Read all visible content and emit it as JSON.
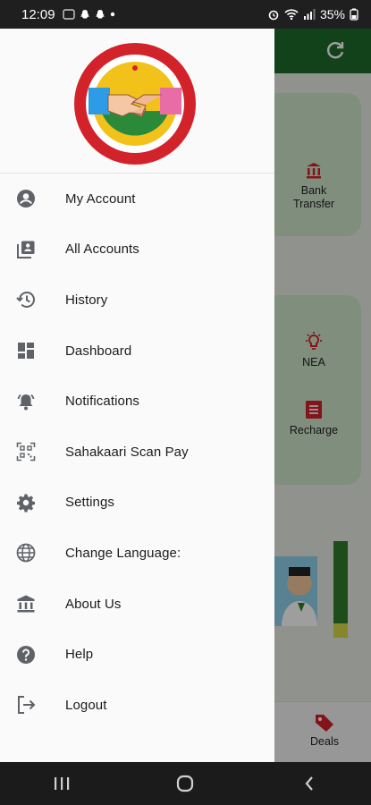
{
  "status_bar": {
    "time": "12:09",
    "battery": "35%"
  },
  "background": {
    "tiles": [
      {
        "label": "Bank\nTransfer",
        "icon": "bank-icon"
      },
      {
        "label": "NEA",
        "icon": "bulb-icon"
      },
      {
        "label": "Recharge",
        "icon": "receipt-icon"
      }
    ],
    "bottom_tab": "Deals"
  },
  "drawer": {
    "logo_name": "Friends Saving & Credit Co-Operative Ltd. logo",
    "items": [
      {
        "label": "My Account",
        "icon": "account-circle-icon"
      },
      {
        "label": "All Accounts",
        "icon": "accounts-list-icon"
      },
      {
        "label": "History",
        "icon": "history-icon"
      },
      {
        "label": "Dashboard",
        "icon": "dashboard-icon"
      },
      {
        "label": "Notifications",
        "icon": "notifications-icon"
      },
      {
        "label": "Sahakaari Scan Pay",
        "icon": "qr-scan-icon"
      },
      {
        "label": "Settings",
        "icon": "settings-gear-icon"
      },
      {
        "label": "Change Language:",
        "icon": "globe-icon"
      },
      {
        "label": "About Us",
        "icon": "institution-icon"
      },
      {
        "label": "Help",
        "icon": "help-icon"
      },
      {
        "label": "Logout",
        "icon": "logout-icon"
      }
    ]
  },
  "colors": {
    "brand_green": "#1e6b2a",
    "icon_gray": "#5f6368",
    "accent_red": "#d3232a"
  }
}
